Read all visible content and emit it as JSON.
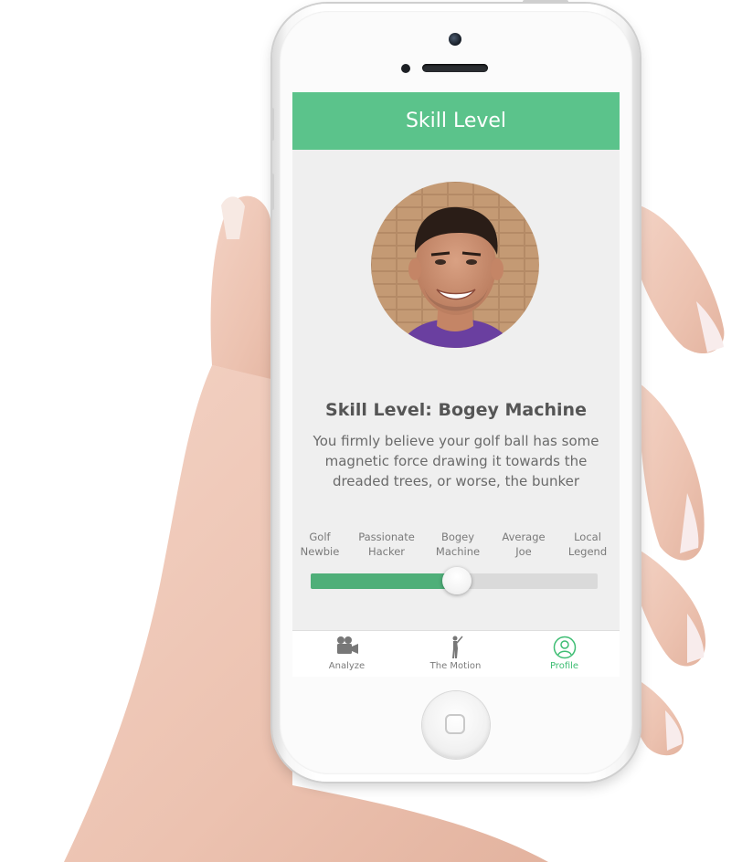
{
  "header": {
    "title": "Skill Level"
  },
  "profile": {
    "level_title": "Skill Level: Bogey Machine",
    "level_description": "You firmly believe your golf ball has some magnetic force drawing it towards the dreaded trees, or worse, the bunker"
  },
  "skill_scale": {
    "levels": [
      {
        "line1": "Golf",
        "line2": "Newbie"
      },
      {
        "line1": "Passionate",
        "line2": "Hacker"
      },
      {
        "line1": "Bogey",
        "line2": "Machine"
      },
      {
        "line1": "Average",
        "line2": "Joe"
      },
      {
        "line1": "Local",
        "line2": "Legend"
      }
    ],
    "selected_index": 2,
    "slider_fraction": 0.51
  },
  "tabbar": {
    "tabs": [
      {
        "label": "Analyze",
        "icon": "video-camera-icon"
      },
      {
        "label": "The Motion",
        "icon": "golfer-swing-icon"
      },
      {
        "label": "Profile",
        "icon": "user-circle-icon"
      }
    ],
    "active_index": 2
  },
  "colors": {
    "accent": "#5bc38b",
    "slider_fill": "#4faf79",
    "active_tab": "#3ebd73",
    "screen_bg": "#efefef"
  }
}
